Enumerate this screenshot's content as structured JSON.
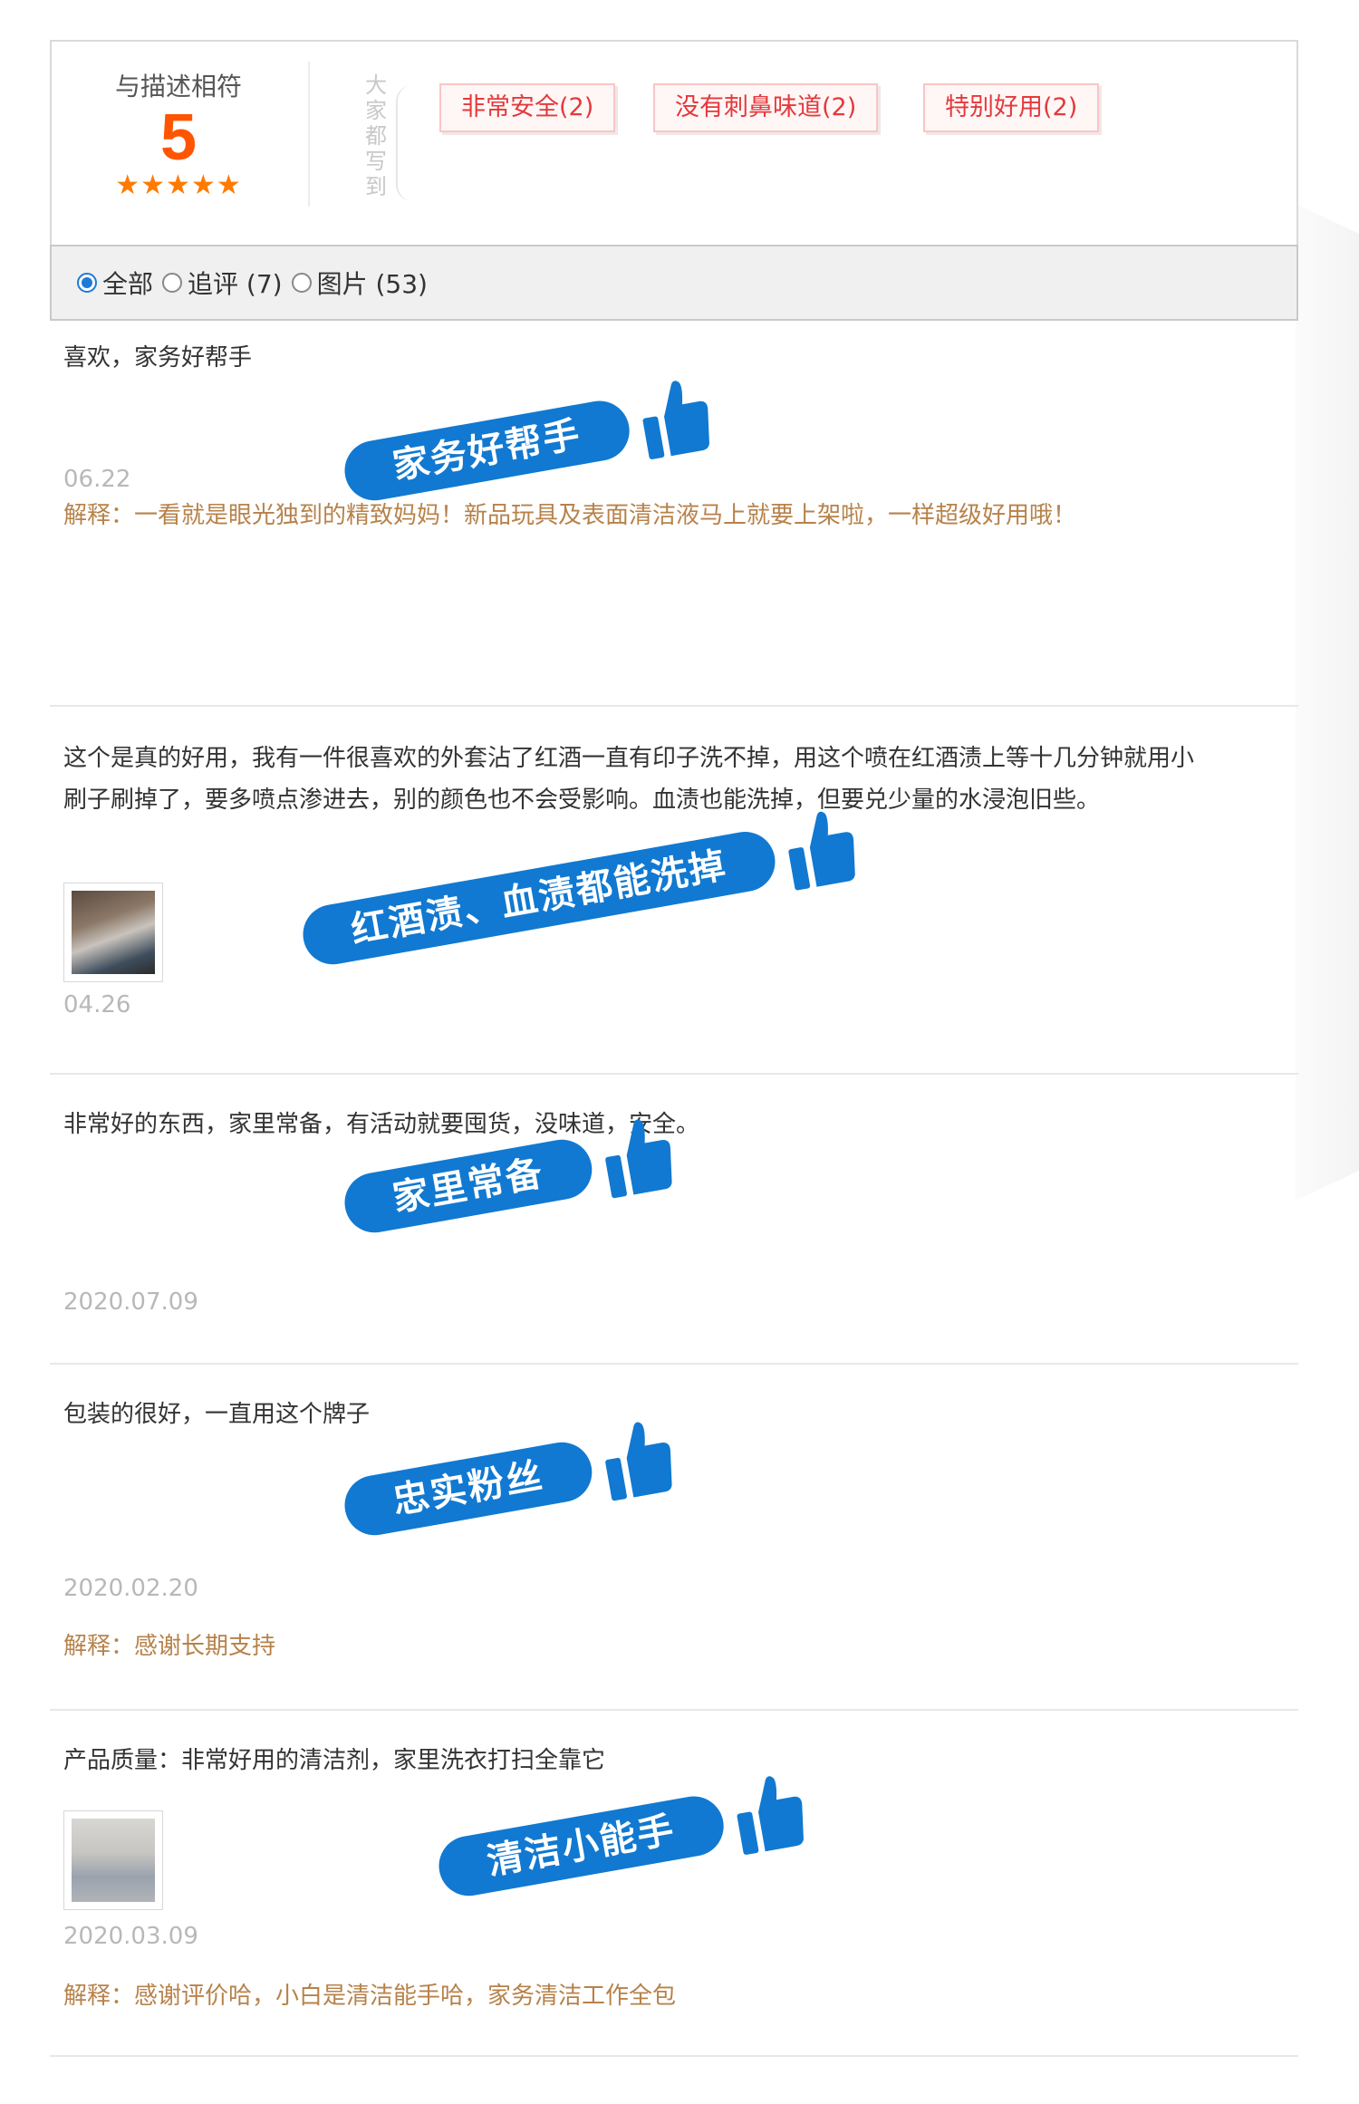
{
  "summary": {
    "score_label": "与描述相符",
    "score_value": "5",
    "stars": "★★★★★",
    "all_wrote": "大家都写到",
    "tags": [
      "非常安全(2)",
      "没有刺鼻味道(2)",
      "特别好用(2)"
    ]
  },
  "filter": {
    "selected": "全部",
    "options": [
      "全部",
      "追评 (7)",
      "图片 (53)"
    ]
  },
  "reviews": [
    {
      "text": "喜欢，家务好帮手",
      "date": "06.22",
      "explanation": "解释：一看就是眼光独到的精致妈妈！新品玩具及表面清洁液马上就要上架啦，一样超级好用哦！",
      "badge": "家务好帮手",
      "has_image": false
    },
    {
      "text": "这个是真的好用，我有一件很喜欢的外套沾了红酒一直有印子洗不掉，用这个喷在红酒渍上等十几分钟就用小刷子刷掉了，要多喷点渗进去，别的颜色也不会受影响。血渍也能洗掉，但要兑少量的水浸泡旧些。",
      "date": "04.26",
      "explanation": "",
      "badge": "红酒渍、血渍都能洗掉",
      "has_image": true
    },
    {
      "text": "非常好的东西，家里常备，有活动就要囤货，没味道，安全。",
      "date": "2020.07.09",
      "explanation": "",
      "badge": "家里常备",
      "has_image": false
    },
    {
      "text": "包装的很好，一直用这个牌子",
      "date": "2020.02.20",
      "explanation": "解释：感谢长期支持",
      "badge": "忠实粉丝",
      "has_image": false
    },
    {
      "text": "产品质量：非常好用的清洁剂，家里洗衣打扫全靠它",
      "date": "2020.03.09",
      "explanation": "解释：感谢评价哈，小白是清洁能手哈，家务清洁工作全包",
      "badge": "清洁小能手",
      "has_image": true
    }
  ],
  "colors": {
    "score": "#ff5500",
    "tag_text": "#e4393c",
    "badge": "#1179d1",
    "explanation": "#b7824a"
  },
  "icons": [
    "thumbs-up-icon",
    "radio-selected-icon",
    "radio-unselected-icon"
  ]
}
